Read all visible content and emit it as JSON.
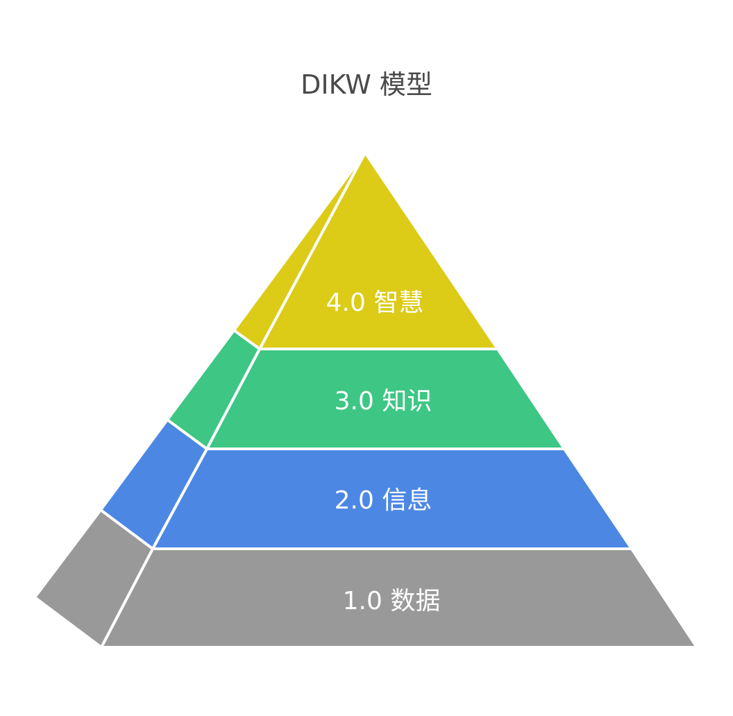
{
  "title": "DIKW 模型",
  "layers": [
    {
      "label": "4.0 智慧",
      "color": "#dccb17"
    },
    {
      "label": "3.0 知识",
      "color": "#3ec684"
    },
    {
      "label": "2.0 信息",
      "color": "#4c87e4"
    },
    {
      "label": "1.0 数据",
      "color": "#999999"
    }
  ]
}
